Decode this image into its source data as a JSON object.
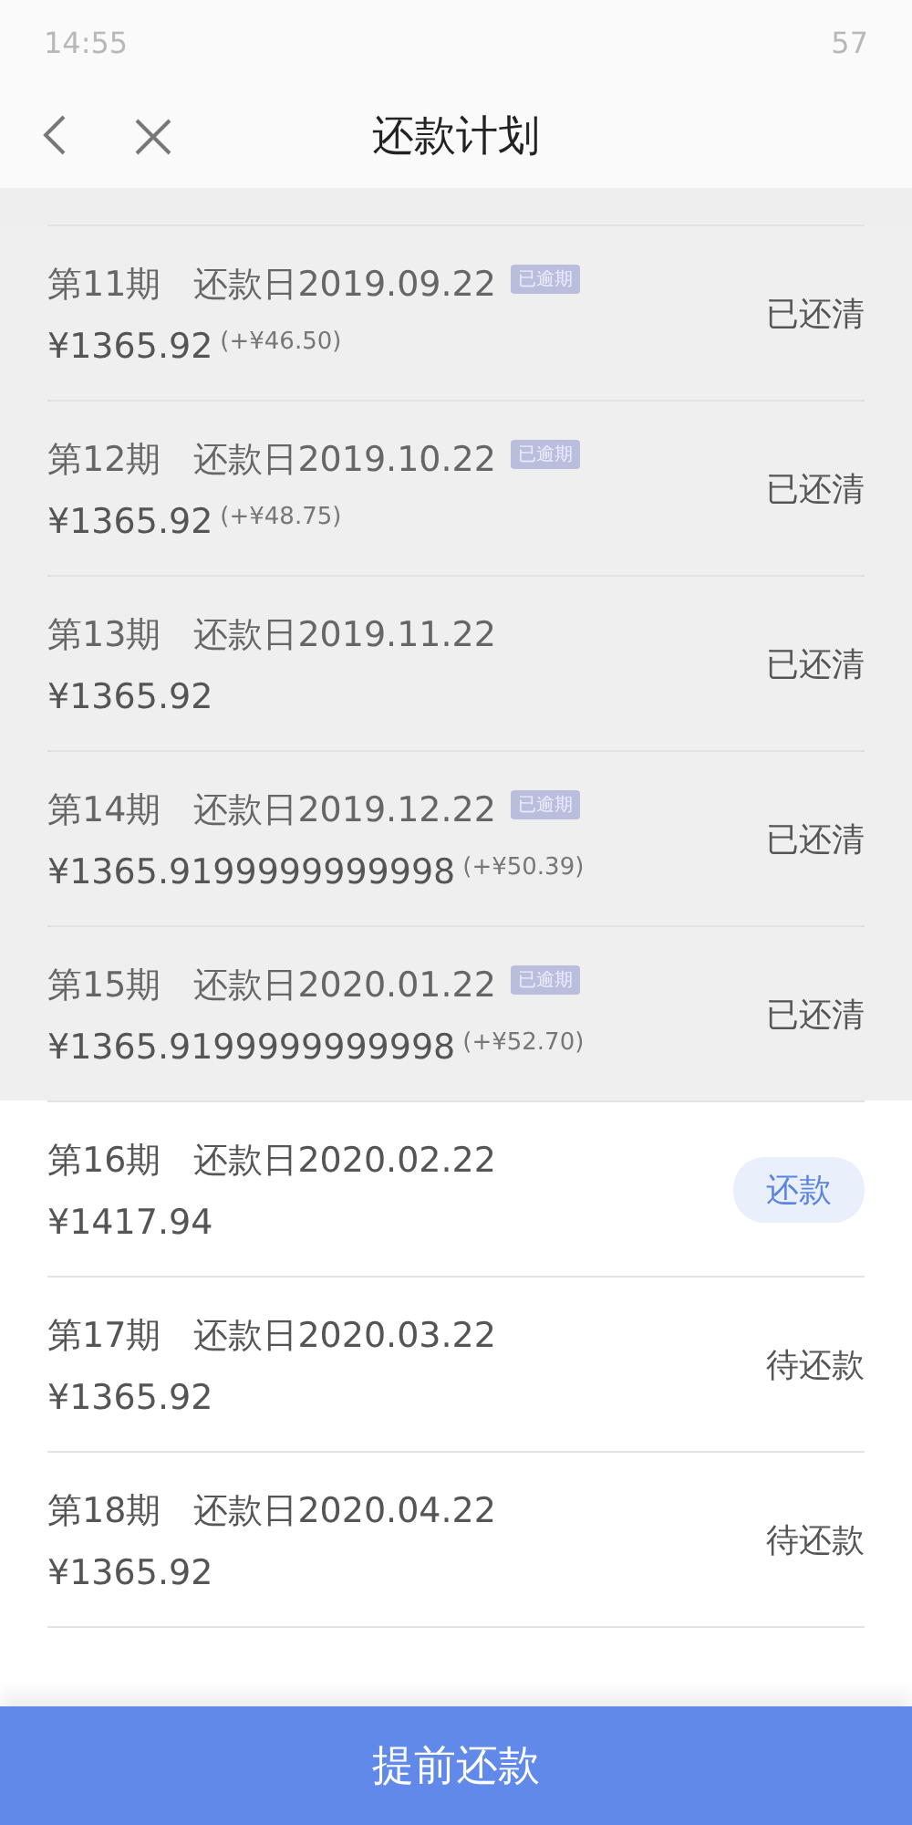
{
  "status_bar": {
    "time": "14:55",
    "battery": "57"
  },
  "nav": {
    "title": "还款计划"
  },
  "installments": [
    {
      "period": "第11期",
      "due_date": "还款日2019.09.22",
      "badge": "已逾期",
      "amount": "¥1365.92",
      "extra": "(+¥46.50)",
      "kind": "paid",
      "action": "已还清"
    },
    {
      "period": "第12期",
      "due_date": "还款日2019.10.22",
      "badge": "已逾期",
      "amount": "¥1365.92",
      "extra": "(+¥48.75)",
      "kind": "paid",
      "action": "已还清"
    },
    {
      "period": "第13期",
      "due_date": "还款日2019.11.22",
      "amount": "¥1365.92",
      "kind": "paid",
      "action": "已还清"
    },
    {
      "period": "第14期",
      "due_date": "还款日2019.12.22",
      "badge": "已逾期",
      "amount": "¥1365.9199999999998",
      "extra": "(+¥50.39)",
      "kind": "paid",
      "action": "已还清"
    },
    {
      "period": "第15期",
      "due_date": "还款日2020.01.22",
      "badge": "已逾期",
      "amount": "¥1365.9199999999998",
      "extra": "(+¥52.70)",
      "kind": "paid",
      "action": "已还清"
    },
    {
      "period": "第16期",
      "due_date": "还款日2020.02.22",
      "amount": "¥1417.94",
      "kind": "due",
      "action": "还款"
    },
    {
      "period": "第17期",
      "due_date": "还款日2020.03.22",
      "amount": "¥1365.92",
      "kind": "pending",
      "action": "待还款"
    },
    {
      "period": "第18期",
      "due_date": "还款日2020.04.22",
      "amount": "¥1365.92",
      "kind": "pending",
      "action": "待还款"
    }
  ],
  "footer_button": "提前还款"
}
